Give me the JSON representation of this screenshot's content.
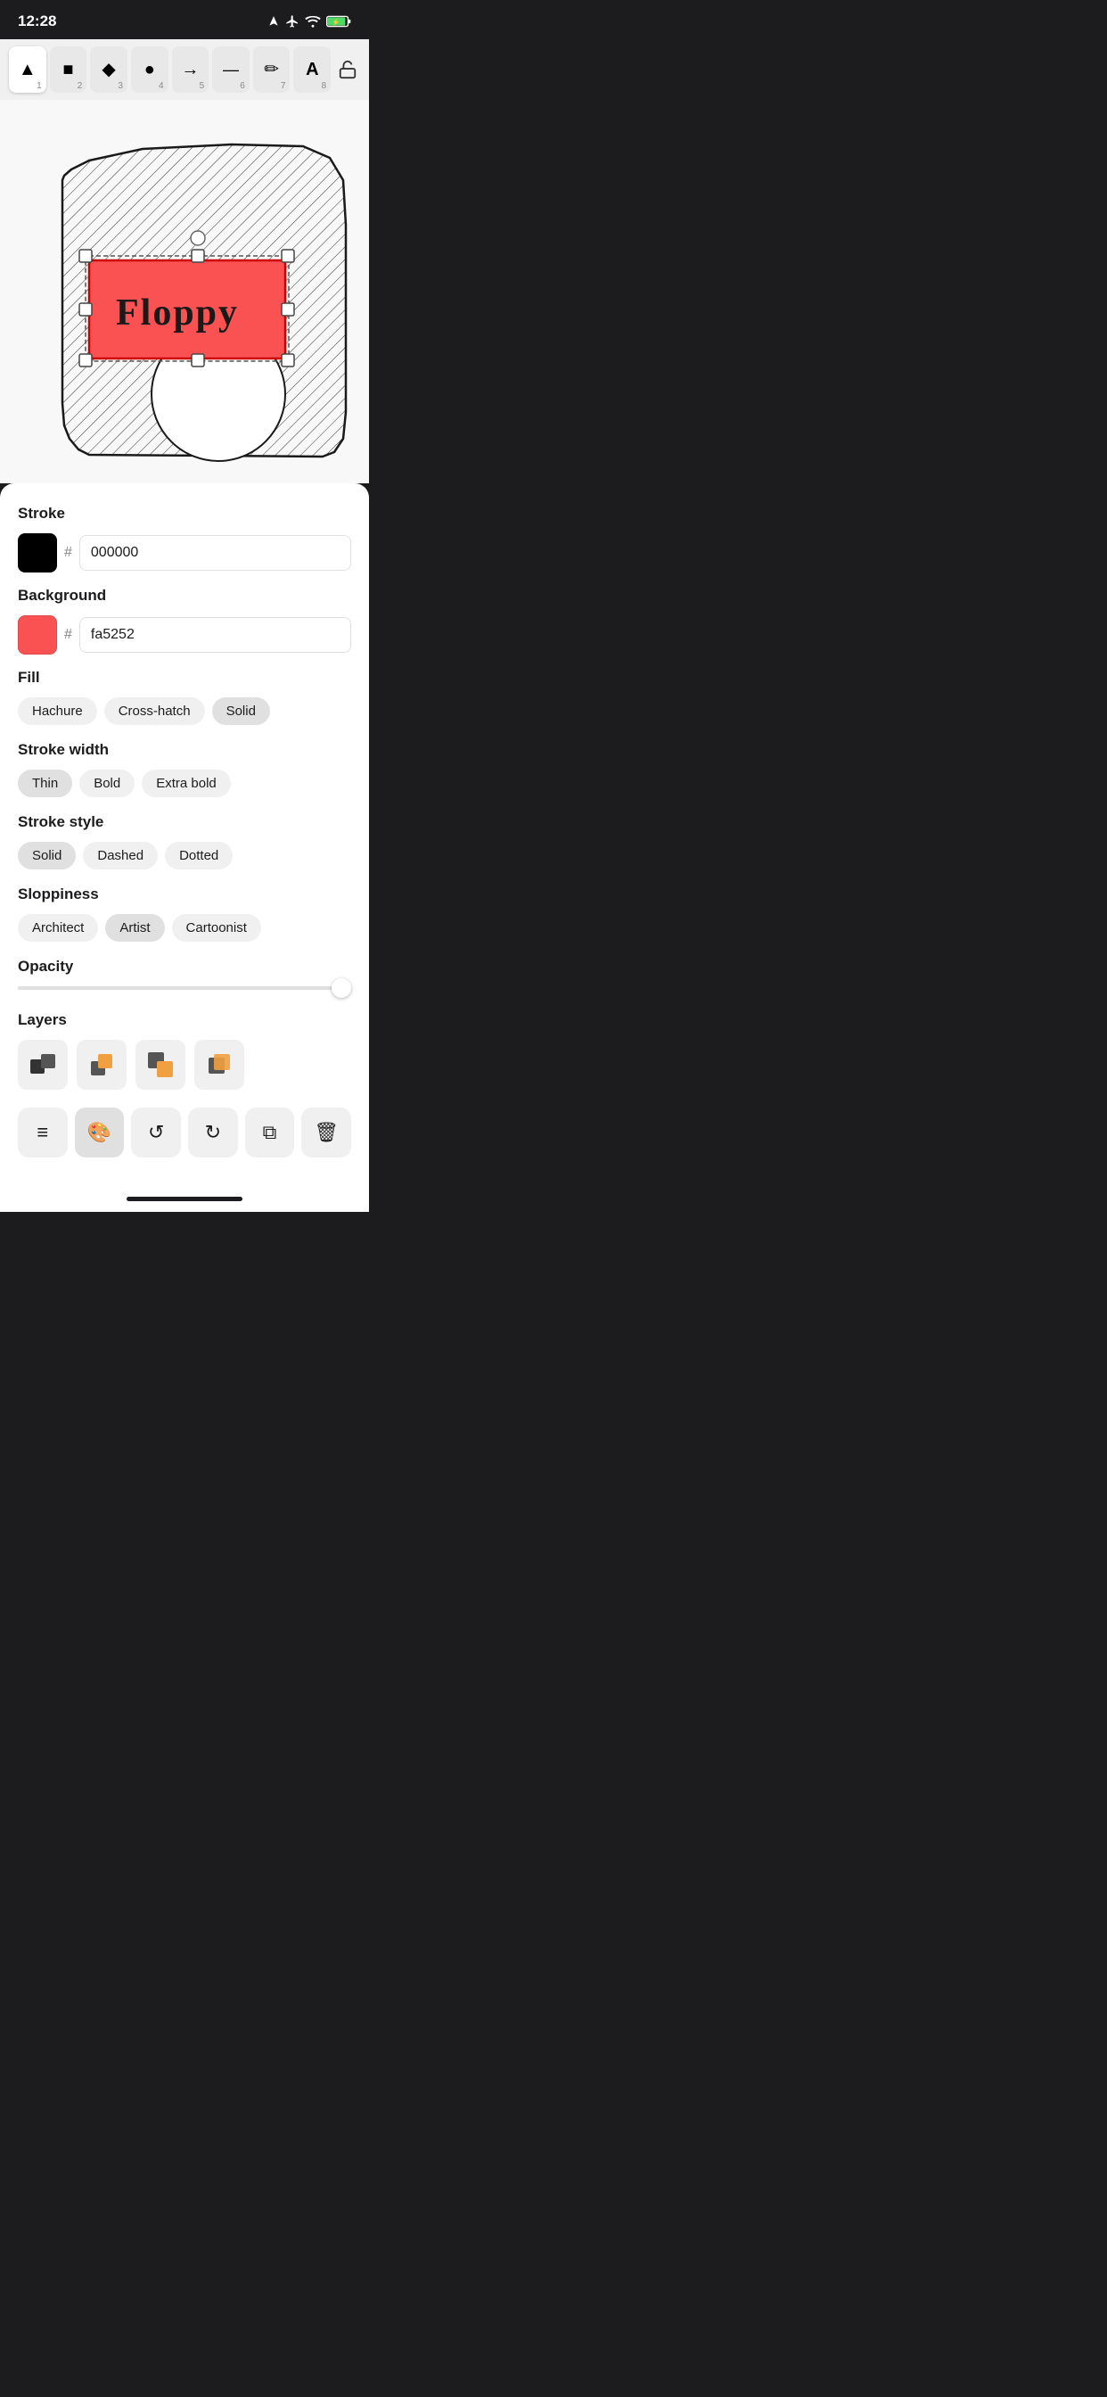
{
  "statusBar": {
    "time": "12:28",
    "locationIcon": "location-arrow-icon"
  },
  "toolbar": {
    "tools": [
      {
        "id": "select",
        "icon": "▲",
        "label": "Select",
        "num": "1",
        "active": true
      },
      {
        "id": "rect",
        "icon": "■",
        "label": "Rectangle",
        "num": "2",
        "active": false
      },
      {
        "id": "diamond",
        "icon": "◆",
        "label": "Diamond",
        "num": "3",
        "active": false
      },
      {
        "id": "circle",
        "icon": "●",
        "label": "Circle",
        "num": "4",
        "active": false
      },
      {
        "id": "arrow",
        "icon": "→",
        "label": "Arrow",
        "num": "5",
        "active": false
      },
      {
        "id": "line",
        "icon": "—",
        "label": "Line",
        "num": "6",
        "active": false
      },
      {
        "id": "pencil",
        "icon": "✏",
        "label": "Pencil",
        "num": "7",
        "active": false
      },
      {
        "id": "text",
        "icon": "A",
        "label": "Text",
        "num": "8",
        "active": false
      }
    ],
    "lockLabel": "Lock"
  },
  "properties": {
    "strokeLabel": "Stroke",
    "strokeColor": "#000000",
    "strokeHex": "000000",
    "backgroundLabel": "Background",
    "bgColor": "#fa5252",
    "bgHex": "fa5252",
    "fillLabel": "Fill",
    "fillOptions": [
      {
        "id": "hachure",
        "label": "Hachure",
        "active": false
      },
      {
        "id": "crosshatch",
        "label": "Cross-hatch",
        "active": false
      },
      {
        "id": "solid",
        "label": "Solid",
        "active": true
      }
    ],
    "strokeWidthLabel": "Stroke width",
    "strokeWidthOptions": [
      {
        "id": "thin",
        "label": "Thin",
        "active": true
      },
      {
        "id": "bold",
        "label": "Bold",
        "active": false
      },
      {
        "id": "extrabold",
        "label": "Extra bold",
        "active": false
      }
    ],
    "strokeStyleLabel": "Stroke style",
    "strokeStyleOptions": [
      {
        "id": "solid",
        "label": "Solid",
        "active": true
      },
      {
        "id": "dashed",
        "label": "Dashed",
        "active": false
      },
      {
        "id": "dotted",
        "label": "Dotted",
        "active": false
      }
    ],
    "sloppinessLabel": "Sloppiness",
    "sloppinessOptions": [
      {
        "id": "architect",
        "label": "Architect",
        "active": false
      },
      {
        "id": "artist",
        "label": "Artist",
        "active": true
      },
      {
        "id": "cartoonist",
        "label": "Cartoonist",
        "active": false
      }
    ],
    "opacityLabel": "Opacity",
    "opacityValue": 100,
    "layersLabel": "Layers",
    "layers": [
      {
        "id": "layer1",
        "icon": "squares-back"
      },
      {
        "id": "layer2",
        "icon": "square-orange"
      },
      {
        "id": "layer3",
        "icon": "squares-overlap"
      },
      {
        "id": "layer4",
        "icon": "square-orange-top"
      }
    ]
  },
  "actionBar": {
    "buttons": [
      {
        "id": "menu",
        "icon": "≡",
        "label": "Menu"
      },
      {
        "id": "style",
        "icon": "🎨",
        "label": "Style",
        "active": true
      },
      {
        "id": "undo",
        "icon": "↺",
        "label": "Undo"
      },
      {
        "id": "redo",
        "icon": "↻",
        "label": "Redo"
      },
      {
        "id": "duplicate",
        "icon": "⧉",
        "label": "Duplicate"
      },
      {
        "id": "delete",
        "icon": "🗑",
        "label": "Delete"
      }
    ]
  },
  "drawing": {
    "title": "Floppy"
  }
}
